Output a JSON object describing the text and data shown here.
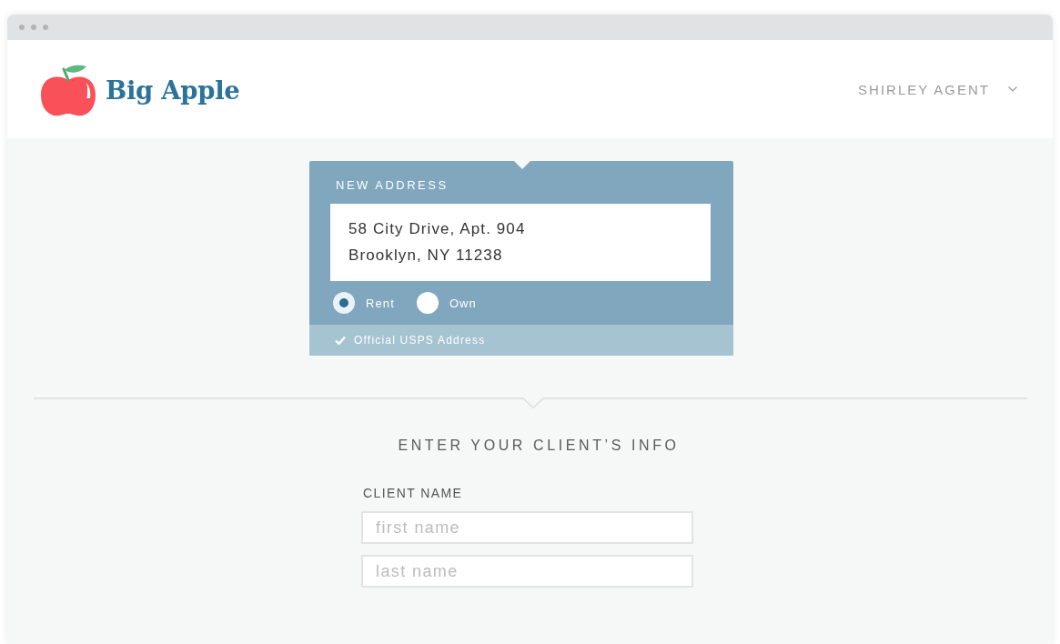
{
  "header": {
    "logo_text": "Big Apple",
    "user_menu": "SHIRLEY AGENT"
  },
  "address_card": {
    "label": "NEW ADDRESS",
    "address_lines": [
      "58 City Drive, Apt. 904",
      "Brooklyn, NY 11238"
    ],
    "tenure_options": [
      {
        "label": "Rent",
        "selected": true
      },
      {
        "label": "Own",
        "selected": false
      }
    ],
    "verification": "Official USPS Address"
  },
  "client_form": {
    "heading": "ENTER YOUR CLIENT’S INFO",
    "fields_label": "CLIENT NAME",
    "fields": [
      {
        "placeholder": "first name"
      },
      {
        "placeholder": "last name"
      }
    ]
  }
}
